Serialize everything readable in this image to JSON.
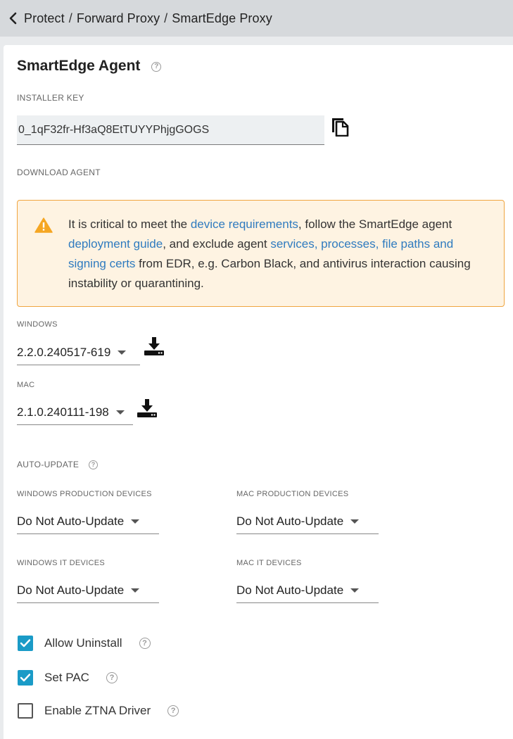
{
  "breadcrumb": {
    "items": [
      "Protect",
      "Forward Proxy",
      "SmartEdge Proxy"
    ],
    "separator": "/"
  },
  "agent": {
    "title": "SmartEdge Agent",
    "installer_key_label": "INSTALLER KEY",
    "installer_key_value": "0_1qF32fr-Hf3aQ8EtTUYYPhjgGOGS",
    "download_agent_label": "DOWNLOAD AGENT"
  },
  "warning": {
    "part1": "It is critical to meet the ",
    "link1": "device requirements",
    "part2": ", follow the SmartEdge agent ",
    "link2": "deployment guide",
    "part3": ", and exclude agent ",
    "link3": "services, processes, file paths and signing certs",
    "part4": " from EDR, e.g. Carbon Black, and antivirus interaction causing instability or quarantining."
  },
  "downloads": {
    "windows_label": "WINDOWS",
    "windows_version": "2.2.0.240517-619",
    "mac_label": "MAC",
    "mac_version": "2.1.0.240111-198"
  },
  "auto_update": {
    "label": "AUTO-UPDATE",
    "windows_production_label": "WINDOWS PRODUCTION DEVICES",
    "windows_production_value": "Do Not Auto-Update",
    "mac_production_label": "MAC PRODUCTION DEVICES",
    "mac_production_value": "Do Not Auto-Update",
    "windows_it_label": "WINDOWS IT DEVICES",
    "windows_it_value": "Do Not Auto-Update",
    "mac_it_label": "MAC IT DEVICES",
    "mac_it_value": "Do Not Auto-Update"
  },
  "options": {
    "allow_uninstall_label": "Allow Uninstall",
    "allow_uninstall_checked": true,
    "set_pac_label": "Set PAC",
    "set_pac_checked": true,
    "enable_ztna_label": "Enable ZTNA Driver",
    "enable_ztna_checked": false
  },
  "help_glyph": "?",
  "colors": {
    "accent": "#1a9bc7",
    "link": "#2f7bbf",
    "warning_border": "#f0a540",
    "warning_bg": "#fef3e2",
    "warning_icon": "#f5a623"
  }
}
